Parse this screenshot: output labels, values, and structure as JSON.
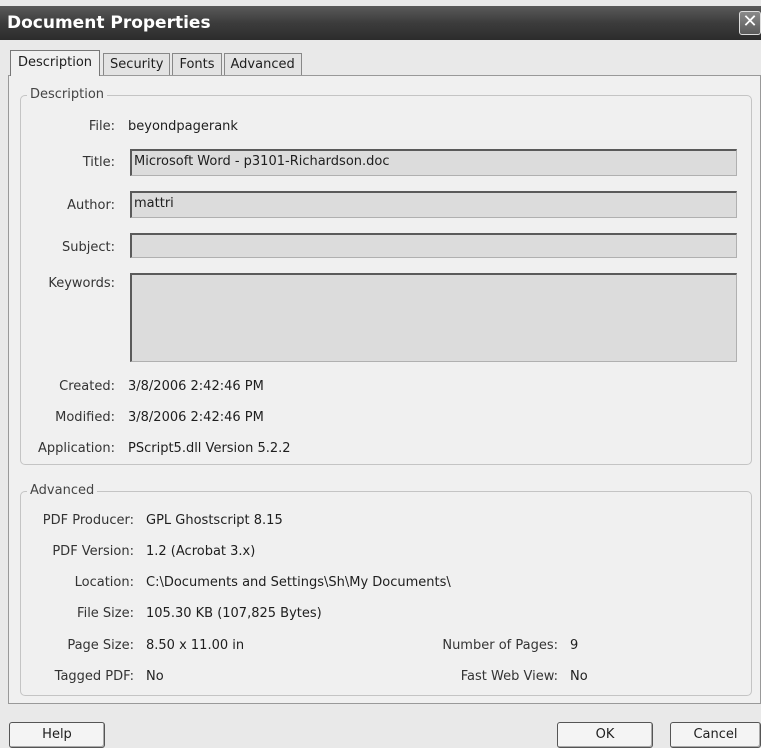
{
  "window": {
    "title": "Document Properties",
    "close_glyph": "✕"
  },
  "tabs": [
    "Description",
    "Security",
    "Fonts",
    "Advanced"
  ],
  "description": {
    "group_title": "Description",
    "file_label": "File:",
    "file_value": "beyondpagerank",
    "title_label": "Title:",
    "title_value": "Microsoft Word - p3101-Richardson.doc",
    "author_label": "Author:",
    "author_value": "mattri",
    "subject_label": "Subject:",
    "subject_value": "",
    "keywords_label": "Keywords:",
    "keywords_value": "",
    "created_label": "Created:",
    "created_value": "3/8/2006 2:42:46 PM",
    "modified_label": "Modified:",
    "modified_value": "3/8/2006 2:42:46 PM",
    "application_label": "Application:",
    "application_value": "PScript5.dll Version 5.2.2"
  },
  "advanced": {
    "group_title": "Advanced",
    "producer_label": "PDF Producer:",
    "producer_value": "GPL Ghostscript 8.15",
    "version_label": "PDF Version:",
    "version_value": "1.2 (Acrobat 3.x)",
    "location_label": "Location:",
    "location_value": "C:\\Documents and Settings\\Sh\\My Documents\\",
    "filesize_label": "File Size:",
    "filesize_value": "105.30 KB (107,825 Bytes)",
    "pagesize_label": "Page Size:",
    "pagesize_value": "8.50 x 11.00 in",
    "numpages_label": "Number of Pages:",
    "numpages_value": "9",
    "tagged_label": "Tagged PDF:",
    "tagged_value": "No",
    "fastweb_label": "Fast Web View:",
    "fastweb_value": "No"
  },
  "buttons": {
    "help": "Help",
    "ok": "OK",
    "cancel": "Cancel"
  }
}
